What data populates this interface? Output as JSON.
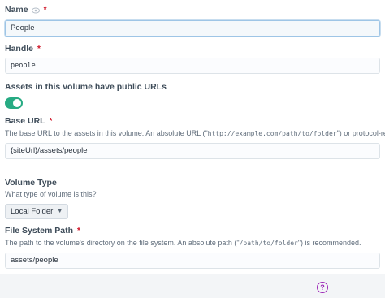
{
  "fields": {
    "name": {
      "label": "Name",
      "required_mark": "*",
      "value": "People"
    },
    "handle": {
      "label": "Handle",
      "required_mark": "*",
      "value": "people"
    },
    "public_urls": {
      "label": "Assets in this volume have public URLs",
      "enabled": true
    },
    "base_url": {
      "label": "Base URL",
      "required_mark": "*",
      "instructions_prefix": "The base URL to the assets in this volume. An absolute URL (\"",
      "instructions_code_1": "http://example.com/path/to/folder",
      "instructions_middle": "\") or protocol-relative URL (\"",
      "instructions_code_2": "//",
      "value": "{siteUrl}/assets/people"
    },
    "volume_type": {
      "label": "Volume Type",
      "instructions": "What type of volume is this?",
      "selected": "Local Folder"
    },
    "file_system_path": {
      "label": "File System Path",
      "required_mark": "*",
      "instructions_prefix": "The path to the volume's directory on the file system. An absolute path (\"",
      "instructions_code": "/path/to/folder",
      "instructions_suffix": "\") is recommended.",
      "value": "assets/people"
    }
  },
  "footer": {
    "help_icon": "question-circle-icon",
    "help_glyph": "?"
  },
  "colors": {
    "required": "#cf1124",
    "toggle_on": "#27ab83",
    "help": "#9b26b6"
  }
}
